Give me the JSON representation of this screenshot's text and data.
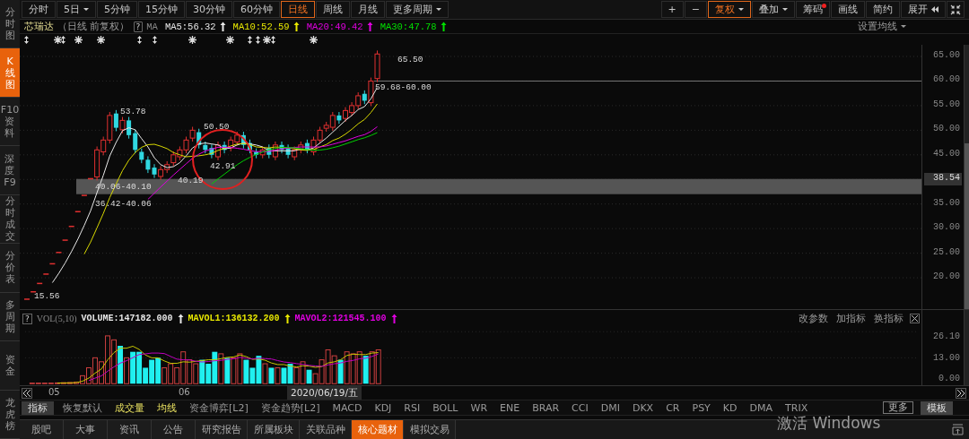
{
  "period_tabs": [
    {
      "label": "分时",
      "selected": false,
      "dropdown": false
    },
    {
      "label": "5日",
      "selected": false,
      "dropdown": true
    },
    {
      "label": "5分钟",
      "selected": false,
      "dropdown": false
    },
    {
      "label": "15分钟",
      "selected": false,
      "dropdown": false
    },
    {
      "label": "30分钟",
      "selected": false,
      "dropdown": false
    },
    {
      "label": "60分钟",
      "selected": false,
      "dropdown": false
    },
    {
      "label": "日线",
      "selected": true,
      "dropdown": false
    },
    {
      "label": "周线",
      "selected": false,
      "dropdown": false
    },
    {
      "label": "月线",
      "selected": false,
      "dropdown": false
    },
    {
      "label": "更多周期",
      "selected": false,
      "dropdown": true
    }
  ],
  "tools": [
    {
      "label": "+",
      "selected": false,
      "dropdown": false,
      "alert": false
    },
    {
      "label": "−",
      "selected": false,
      "dropdown": false,
      "alert": false
    },
    {
      "label": "复权",
      "selected": true,
      "dropdown": true,
      "alert": false
    },
    {
      "label": "叠加",
      "selected": false,
      "dropdown": true,
      "alert": false
    },
    {
      "label": "筹码",
      "selected": false,
      "dropdown": false,
      "alert": true
    },
    {
      "label": "画线",
      "selected": false,
      "dropdown": false,
      "alert": false
    },
    {
      "label": "简约",
      "selected": false,
      "dropdown": false,
      "alert": false
    }
  ],
  "expand_button": "展开",
  "side_tabs": [
    {
      "label": "分时图",
      "selected": false
    },
    {
      "label": "K线图",
      "selected": true
    },
    {
      "label": "F10资料",
      "selected": false
    },
    {
      "label": "深度F9",
      "selected": false
    },
    {
      "label": "分时成交",
      "selected": false
    },
    {
      "label": "分价表",
      "selected": false
    },
    {
      "label": "多周期",
      "selected": false
    },
    {
      "label": "资金",
      "selected": false
    },
    {
      "label": "龙虎榜",
      "selected": false
    }
  ],
  "legend": {
    "stock": "芯瑞达",
    "mode": "（日线 前复权）",
    "help": "?",
    "indicator": "MA",
    "values": [
      {
        "text": "MA5:56.32",
        "color": "#e8e8e8"
      },
      {
        "text": "MA10:52.59",
        "color": "#e8e800"
      },
      {
        "text": "MA20:49.42",
        "color": "#e000e0"
      },
      {
        "text": "MA30:47.78",
        "color": "#00e000"
      }
    ],
    "settings": "设置均线"
  },
  "event_markers": [
    {
      "kind": "split"
    },
    {
      "kind": "star"
    },
    {
      "kind": "split"
    },
    {
      "kind": "star"
    },
    {
      "kind": "star"
    },
    {
      "kind": "split"
    },
    {
      "kind": "split"
    },
    {
      "kind": "star"
    },
    {
      "kind": "star"
    },
    {
      "kind": "split"
    },
    {
      "kind": "split"
    },
    {
      "kind": "star"
    },
    {
      "kind": "split"
    },
    {
      "kind": "star"
    }
  ],
  "price_axis": [
    {
      "label": "65.00",
      "current": false
    },
    {
      "label": "60.00",
      "current": false
    },
    {
      "label": "55.00",
      "current": false
    },
    {
      "label": "50.00",
      "current": false
    },
    {
      "label": "45.00",
      "current": false
    },
    {
      "label": "38.54",
      "current": true
    },
    {
      "label": "35.00",
      "current": false
    },
    {
      "label": "30.00",
      "current": false
    },
    {
      "label": "25.00",
      "current": false
    },
    {
      "label": "20.00",
      "current": false
    }
  ],
  "price_annotations": [
    "65.50",
    "59.68-60.00",
    "53.78",
    "50.50",
    "42.91",
    "40.19",
    "40.06-40.10",
    "36.42-40.06",
    "15.56"
  ],
  "volume": {
    "help": "?",
    "name": "VOL(5,10)",
    "values": [
      {
        "text": "VOLUME:147182.000",
        "color": "#e8e8e8"
      },
      {
        "text": "MAVOL1:136132.200",
        "color": "#e8e800"
      },
      {
        "text": "MAVOL2:121545.100",
        "color": "#e000e0"
      }
    ],
    "actions": [
      "改参数",
      "加指标",
      "换指标"
    ],
    "axis": [
      "26.10",
      "13.00",
      "0.00"
    ]
  },
  "x_axis": {
    "labels": [
      "05",
      "06"
    ],
    "cursor_date": "2020/06/19/五"
  },
  "indicator_tabs": [
    {
      "label": "指标",
      "kind": "header"
    },
    {
      "label": "恢复默认",
      "kind": "tab",
      "active": false
    },
    {
      "label": "成交量",
      "kind": "tab",
      "active": true
    },
    {
      "label": "均线",
      "kind": "tab",
      "active": true
    },
    {
      "label": "资金博弈[L2]",
      "kind": "tab",
      "active": false
    },
    {
      "label": "资金趋势[L2]",
      "kind": "tab",
      "active": false
    },
    {
      "label": "MACD",
      "kind": "tab",
      "active": false
    },
    {
      "label": "KDJ",
      "kind": "tab",
      "active": false
    },
    {
      "label": "RSI",
      "kind": "tab",
      "active": false
    },
    {
      "label": "BOLL",
      "kind": "tab",
      "active": false
    },
    {
      "label": "WR",
      "kind": "tab",
      "active": false
    },
    {
      "label": "ENE",
      "kind": "tab",
      "active": false
    },
    {
      "label": "BRAR",
      "kind": "tab",
      "active": false
    },
    {
      "label": "CCI",
      "kind": "tab",
      "active": false
    },
    {
      "label": "DMI",
      "kind": "tab",
      "active": false
    },
    {
      "label": "DKX",
      "kind": "tab",
      "active": false
    },
    {
      "label": "CR",
      "kind": "tab",
      "active": false
    },
    {
      "label": "PSY",
      "kind": "tab",
      "active": false
    },
    {
      "label": "KD",
      "kind": "tab",
      "active": false
    },
    {
      "label": "DMA",
      "kind": "tab",
      "active": false
    },
    {
      "label": "TRIX",
      "kind": "tab",
      "active": false
    },
    {
      "label": "更多",
      "kind": "more"
    },
    {
      "label": "模板",
      "kind": "template"
    }
  ],
  "bottom_tabs": [
    {
      "label": "股吧",
      "selected": false
    },
    {
      "label": "大事",
      "selected": false
    },
    {
      "label": "资讯",
      "selected": false
    },
    {
      "label": "公告",
      "selected": false
    },
    {
      "label": "研究报告",
      "selected": false
    },
    {
      "label": "所属板块",
      "selected": false
    },
    {
      "label": "关联品种",
      "selected": false
    },
    {
      "label": "核心题材",
      "selected": true
    },
    {
      "label": "模拟交易",
      "selected": false
    }
  ],
  "os_notice": "激活 Windows"
}
